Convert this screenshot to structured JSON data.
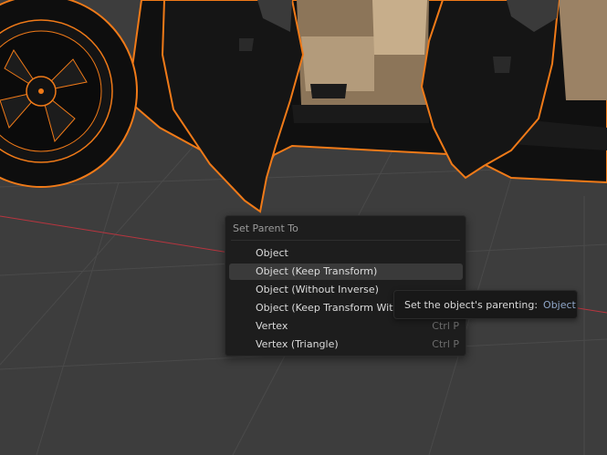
{
  "menu": {
    "title": "Set Parent To",
    "items": [
      {
        "label": "Object",
        "shortcut": ""
      },
      {
        "label": "Object (Keep Transform)",
        "shortcut": ""
      },
      {
        "label": "Object (Without Inverse)",
        "shortcut": ""
      },
      {
        "label": "Object (Keep Transform With",
        "shortcut": ""
      },
      {
        "label": "Vertex",
        "shortcut": "Ctrl P"
      },
      {
        "label": "Vertex (Triangle)",
        "shortcut": "Ctrl P"
      }
    ]
  },
  "tooltip": {
    "text": "Set the object's parenting:",
    "value": "Object"
  },
  "colors": {
    "selection_outline": "#f07a18",
    "grid": "#4a4a4a",
    "x_axis": "#b8353f",
    "tooltip_value": "#8fa6c8"
  },
  "icons": [
    "car-3d-model"
  ]
}
